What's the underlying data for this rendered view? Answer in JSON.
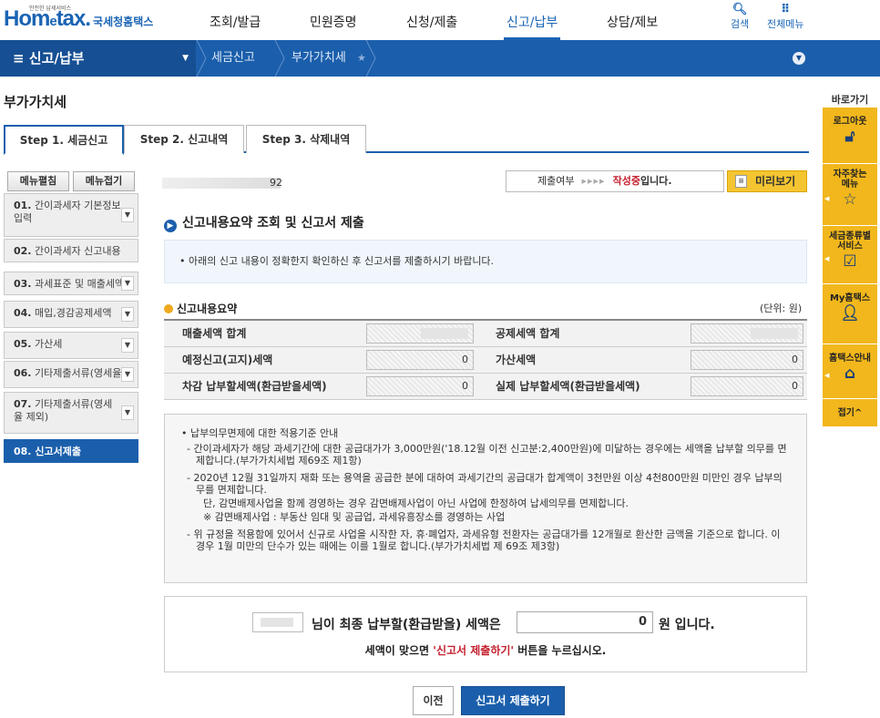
{
  "header": {
    "logo_small": "안전한 납세서비스",
    "logo_main_1": "Hom",
    "logo_main_e": "e",
    "logo_main_2": "tax.",
    "logo_sub": "국세청홈택스",
    "gnb": [
      "조회/발급",
      "민원증명",
      "신청/제출",
      "신고/납부",
      "상담/제보"
    ],
    "active_gnb": "신고/납부",
    "search_label": "검색",
    "all_menu_label": "전체메뉴"
  },
  "navbar": {
    "menu_title": "≡  신고/납부",
    "crumbs": [
      "세금신고",
      "부가가치세"
    ]
  },
  "page_title": "부가가치세",
  "tabs": [
    "Step 1. 세금신고",
    "Step 2. 신고내역",
    "Step 3. 삭제내역"
  ],
  "left_menu": {
    "expand_label": "메뉴펼침",
    "collapse_label": "메뉴접기",
    "items": [
      {
        "num": "01.",
        "label": "간이과세자 기본정보 입력"
      },
      {
        "num": "02.",
        "label": "간이과세자 신고내용"
      },
      {
        "num": "03.",
        "label": "과세표준 및 매출세액"
      },
      {
        "num": "04.",
        "label": "매입,경감공제세액"
      },
      {
        "num": "05.",
        "label": "가산세"
      },
      {
        "num": "06.",
        "label": "기타제출서류(영세율"
      },
      {
        "num": "07.",
        "label": "기타제출서류(영세율 제외)"
      },
      {
        "num": "08.",
        "label": "신고서제출"
      }
    ]
  },
  "quick": {
    "title": "바로가기",
    "items": [
      "로그아웃",
      "자주찾는 메뉴",
      "세금종류별 서비스",
      "My홈택스",
      "홈택스안내",
      "접기^"
    ]
  },
  "main": {
    "id_suffix": "92",
    "submit_status_label": "제출여부",
    "submit_status_arrows": "▸▸▸▸",
    "submit_status_value": "작성중",
    "submit_status_suffix": "입니다.",
    "preview_label": "미리보기",
    "section_title": "신고내용요약 조회 및 신고서 제출",
    "notice": "• 아래의 신고 내용이 정확한지 확인하신 후 신고서를 제출하시기 바랍니다.",
    "summary_title": "신고내용요약",
    "unit": "(단위: 원)",
    "rows": [
      {
        "label1": "매출세액 합계",
        "value1": "",
        "label2": "공제세액 합계",
        "value2": ""
      },
      {
        "label1": "예정신고(고지)세액",
        "value1": "0",
        "label2": "가산세액",
        "value2": "0"
      },
      {
        "label1": "차감 납부할세액(환급받을세액)",
        "value1": "0",
        "label2": "실제 납부할세액(환급받을세액)",
        "value2": "0"
      }
    ],
    "info": {
      "head": "• 납부의무면제에 대한 적용기준 안내",
      "p1": "- 간이과세자가 해당 과세기간에 대한 공급대가가 3,000만원('18.12월 이전 신고분:2,400만원)에 미달하는 경우에는 세액을 납부할 의무를 면제합니다.(부가가치세법 제69조 제1항)",
      "p2": "- 2020년 12월 31일까지 재화 또는 용역을 공급한 분에 대하여 과세기간의 공급대가 합계액이 3천만원 이상 4천800만원 미만인 경우 납부의무를 면제합니다.",
      "p2b": "단, 감면배제사업을 함께 경영하는 경우 감면배제사업이 아닌 사업에 한정하여 납세의무를 면제합니다.",
      "p2c": "※ 감면배제사업 : 부동산 임대 및 공급업, 과세유흥장소를 경영하는 사업",
      "p3": "- 위 규정을 적용함에 있어서 신규로 사업을 시작한 자, 휴·폐업자, 과세유형 전환자는 공급대가를 12개월로 환산한 금액을 기준으로 합니다. 이 경우 1월 미만의 단수가 있는 때에는 이를 1월로 합니다.(부가가치세법 제 69조 제3항)"
    },
    "final": {
      "text1": "님이 최종 납부할(환급받을) 세액은",
      "amount": "0",
      "text2": "원 입니다.",
      "hint_pre": "세액이 맞으면 ",
      "hint_red": "'신고서 제출하기'",
      "hint_post": " 버튼을 누르십시오."
    },
    "prev_button": "이전",
    "submit_button": "신고서 제출하기"
  }
}
